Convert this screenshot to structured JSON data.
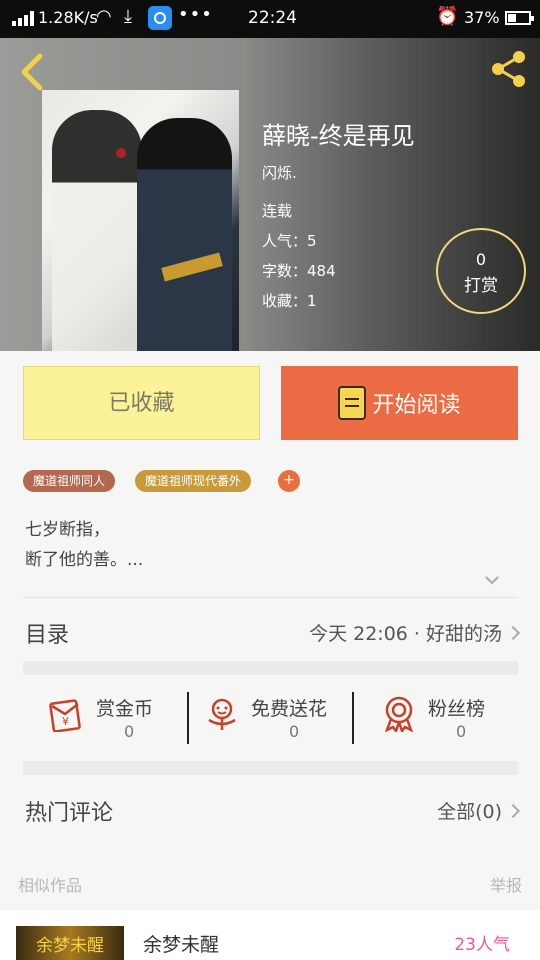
{
  "status_bar": {
    "speed": "1.28K/s",
    "time": "22:24",
    "battery": "37%",
    "icons": [
      "signal-icon",
      "wifi-icon",
      "download-icon",
      "app-notification-icon",
      "more-dots-icon",
      "alarm-icon",
      "battery-icon"
    ]
  },
  "book": {
    "title": "薛晓-终是再见",
    "author": "闪烁.",
    "status": "连载",
    "popularity_label": "人气：",
    "popularity": "5",
    "words_label": "字数：",
    "words": "484",
    "favorites_label": "收藏：",
    "favorites": "1"
  },
  "tip": {
    "count": "0",
    "label": "打赏"
  },
  "actions": {
    "favorite_label": "已收藏",
    "read_label": "开始阅读"
  },
  "tags": [
    "魔道祖师同人",
    "魔道祖师现代番外"
  ],
  "tag_add": "+",
  "description": {
    "line1": "七岁断指，",
    "line2": "断了他的善。..."
  },
  "toc": {
    "label": "目录",
    "latest": "今天 22:06 · 好甜的汤"
  },
  "stats": [
    {
      "label": "赏金币",
      "value": "0",
      "icon": "coin-envelope-icon"
    },
    {
      "label": "免费送花",
      "value": "0",
      "icon": "flower-icon"
    },
    {
      "label": "粉丝榜",
      "value": "0",
      "icon": "medal-icon"
    }
  ],
  "comments": {
    "label": "热门评论",
    "count": "全部(0)"
  },
  "footer": {
    "similar_label": "相似作品",
    "report_label": "举报"
  },
  "similar_item": {
    "thumb_text": "余梦未醒",
    "name": "余梦未醒",
    "popularity": "23人气"
  },
  "colors": {
    "accent_orange": "#ea6b44",
    "favorite_yellow": "#fbf396",
    "tag_brown": "#b46850",
    "tag_gold": "#c89a3a",
    "tip_ring": "#f0d97a",
    "icon_red": "#c8402a",
    "popularity_pink": "#e85a9a"
  }
}
